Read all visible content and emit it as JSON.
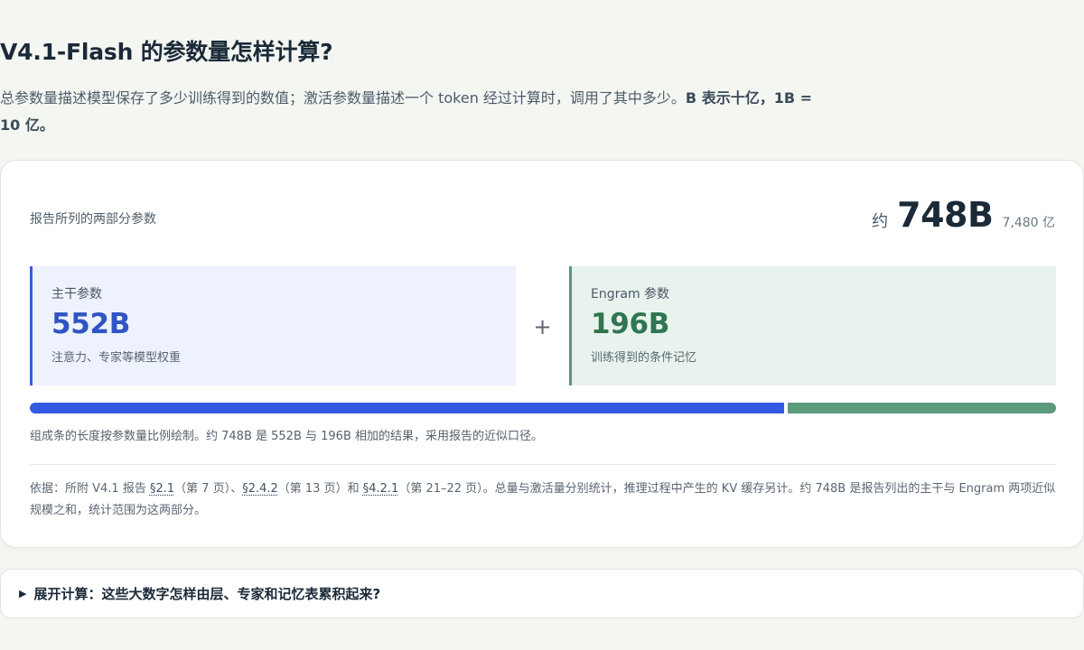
{
  "page": {
    "title": "V4.1-Flash 的参数量怎样计算?",
    "lead_text": "总参数量描述模型保存了多少训练得到的数值；激活参数量描述一个 token 经过计算时，调用了其中多少。",
    "lead_bold": "B 表示十亿，1B = 10 亿。"
  },
  "card": {
    "label": "报告所列的两部分参数",
    "total_prefix": "约",
    "total_value": "748B",
    "total_sub": "7,480 亿",
    "parts": [
      {
        "name": "主干参数",
        "value": "552B",
        "desc": "注意力、专家等模型权重",
        "color": "#3459e3"
      },
      {
        "name": "Engram 参数",
        "value": "196B",
        "desc": "训练得到的条件记忆",
        "color": "#5c9a7c"
      }
    ],
    "plus": "+",
    "bar": {
      "main_fraction": 0.738,
      "engram_fraction": 0.262
    },
    "bar_note": "组成条的长度按参数量比例绘制。约 748B 是 552B 与 196B 相加的结果，采用报告的近似口径。",
    "basis": {
      "t1": "依据：所附 V4.1 报告 ",
      "ref1": "§2.1",
      "t2": "（第 7 页）、",
      "ref2": "§2.4.2",
      "t3": "（第 13 页）和 ",
      "ref3": "§4.2.1",
      "t4": "（第 21–22 页）。总量与激活量分别统计，推理过程中产生的 KV 缓存另计。约 748B 是报告列出的主干与 Engram 两项近似规模之和，统计范围为这两部分。"
    }
  },
  "details": {
    "icon": "triangle-right-icon",
    "label": "展开计算：这些大数字怎样由层、专家和记忆表累积起来?"
  }
}
